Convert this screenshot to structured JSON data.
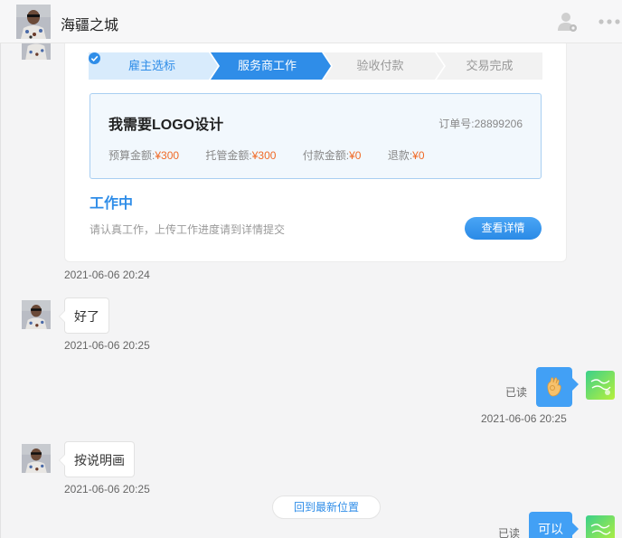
{
  "header": {
    "contact_name": "海疆之城",
    "icons": [
      "user-icon",
      "more-icon"
    ]
  },
  "order_card": {
    "steps": [
      "雇主选标",
      "服务商工作",
      "验收付款",
      "交易完成"
    ],
    "current_step": 2,
    "title": "我需要LOGO设计",
    "order_no_label": "订单号:",
    "order_no": "28899206",
    "amounts": [
      {
        "label": "预算金额:",
        "value": "¥300"
      },
      {
        "label": "托管金额:",
        "value": "¥300"
      },
      {
        "label": "付款金额:",
        "value": "¥0"
      },
      {
        "label": "退款:",
        "value": "¥0"
      }
    ],
    "status_title": "工作中",
    "status_desc": "请认真工作，上传工作进度请到详情提交",
    "detail_button": "查看详情",
    "time": "2021-06-06 20:24"
  },
  "messages": [
    {
      "side": "left",
      "text": "好了",
      "time": "2021-06-06 20:25"
    },
    {
      "side": "right",
      "content": "ok-hand-emoji",
      "read": "已读",
      "time": "2021-06-06 20:25"
    },
    {
      "side": "left",
      "text": "按说明画",
      "time": "2021-06-06 20:25"
    },
    {
      "side": "right",
      "text": "可以",
      "read": "已读"
    }
  ],
  "back_to_latest": "回到最新位置",
  "colors": {
    "accent": "#2f8de8",
    "money": "#f06a27",
    "bubble_right": "#42a0f5"
  }
}
